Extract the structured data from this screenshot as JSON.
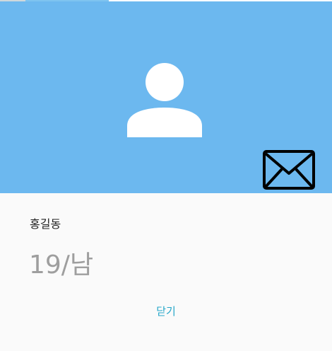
{
  "colors": {
    "header_bg": "#6cb8ef",
    "content_bg": "#fafafa",
    "accent": "#26a7c9",
    "subtext": "#9e9e9e"
  },
  "header": {
    "avatar_icon": "person-icon",
    "mail_icon": "envelope-icon"
  },
  "profile": {
    "name": "홍길동",
    "age_gender": "19/남"
  },
  "actions": {
    "close_label": "닫기"
  }
}
